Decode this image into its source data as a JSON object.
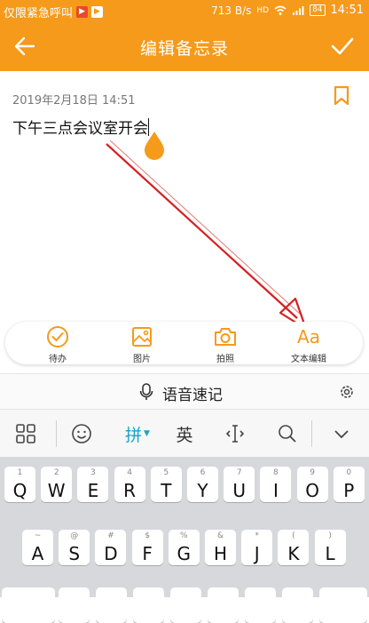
{
  "status_bar": {
    "carrier": "仅限紧急呼叫",
    "speed": "713 B/s",
    "battery": "84",
    "time": "14:51"
  },
  "header": {
    "title": "编辑备忘录"
  },
  "note": {
    "date": "2019年2月18日 14:51",
    "content": "下午三点会议室开会"
  },
  "toolbar": {
    "items": [
      {
        "label": "待办",
        "icon": "checkbox-icon"
      },
      {
        "label": "图片",
        "icon": "image-icon"
      },
      {
        "label": "拍照",
        "icon": "camera-icon"
      },
      {
        "label": "文本编辑",
        "icon": "text-format-icon",
        "glyph": "Aa"
      }
    ]
  },
  "voice": {
    "label": "语音速记"
  },
  "keyboard": {
    "mode_pinyin": "拼",
    "mode_english": "英",
    "row1": [
      {
        "num": "1",
        "key": "Q"
      },
      {
        "num": "2",
        "key": "W"
      },
      {
        "num": "3",
        "key": "E"
      },
      {
        "num": "4",
        "key": "R"
      },
      {
        "num": "5",
        "key": "T"
      },
      {
        "num": "6",
        "key": "Y"
      },
      {
        "num": "7",
        "key": "U"
      },
      {
        "num": "8",
        "key": "I"
      },
      {
        "num": "9",
        "key": "O"
      },
      {
        "num": "0",
        "key": "P"
      }
    ],
    "row2": [
      {
        "sym": "~",
        "key": "A"
      },
      {
        "sym": "@",
        "key": "S"
      },
      {
        "sym": "#",
        "key": "D"
      },
      {
        "sym": "$",
        "key": "F"
      },
      {
        "sym": "%",
        "key": "G"
      },
      {
        "sym": "&",
        "key": "H"
      },
      {
        "sym": "*",
        "key": "J"
      },
      {
        "sym": "(",
        "key": "K"
      },
      {
        "sym": ")",
        "key": "L"
      }
    ]
  },
  "colors": {
    "accent": "#f59a1b",
    "annotation_arrow": "#d42020"
  }
}
